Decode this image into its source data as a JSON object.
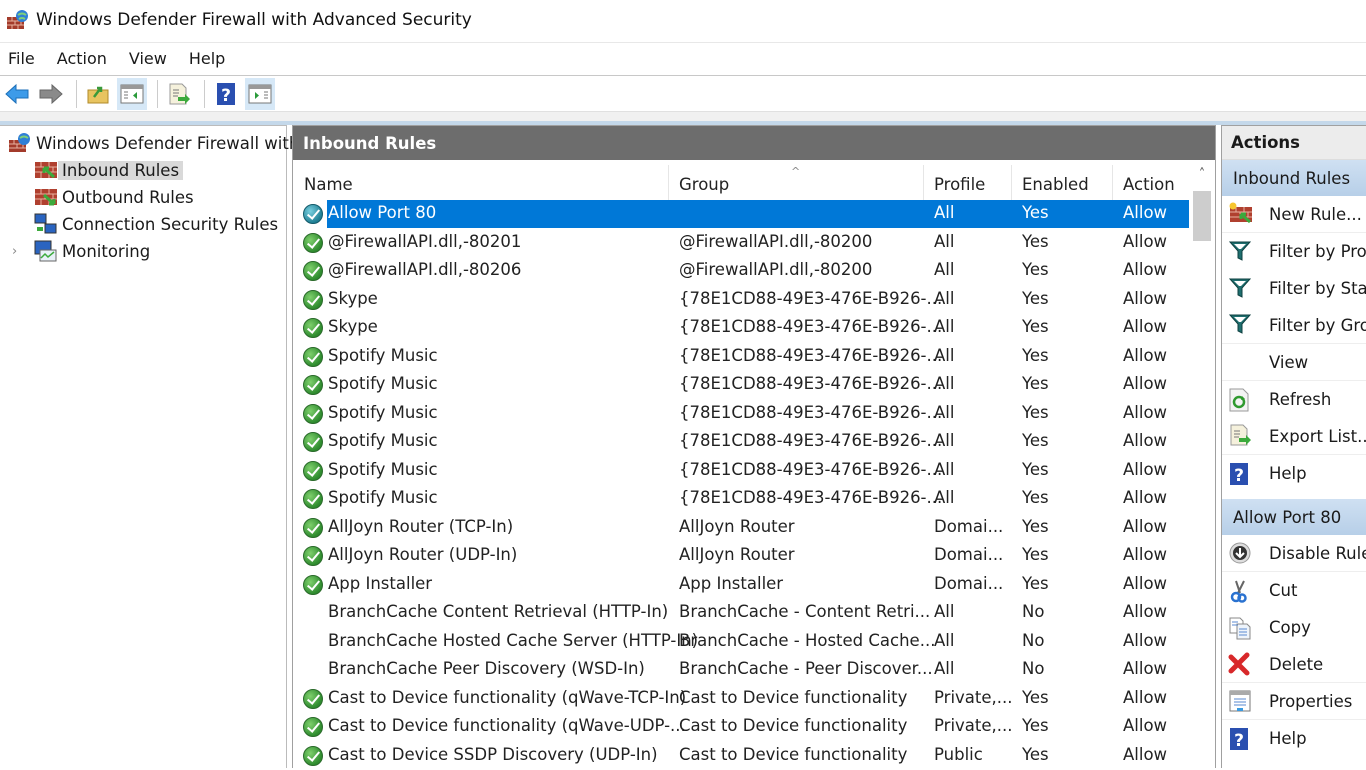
{
  "window": {
    "title": "Windows Defender Firewall with Advanced Security"
  },
  "menu": [
    "File",
    "Action",
    "View",
    "Help"
  ],
  "toolbar": [
    "back-icon",
    "forward-icon",
    "up-folder-icon",
    "show-hide-console-tree-icon",
    "export-list-icon",
    "help-icon",
    "show-hide-action-pane-icon"
  ],
  "tree": {
    "root": "Windows Defender Firewall with",
    "items": [
      {
        "label": "Inbound Rules",
        "selected": true
      },
      {
        "label": "Outbound Rules"
      },
      {
        "label": "Connection Security Rules"
      },
      {
        "label": "Monitoring",
        "expandable": true
      }
    ]
  },
  "center": {
    "title": "Inbound Rules",
    "columns": [
      "Name",
      "Group",
      "Profile",
      "Enabled",
      "Action"
    ],
    "sort_indicator": "^",
    "rows": [
      {
        "name": "Allow Port 80",
        "group": "",
        "profile": "All",
        "enabled": "Yes",
        "action": "Allow",
        "icon": "custom-enabled",
        "selected": true
      },
      {
        "name": "@FirewallAPI.dll,-80201",
        "group": "@FirewallAPI.dll,-80200",
        "profile": "All",
        "enabled": "Yes",
        "action": "Allow",
        "icon": "enabled"
      },
      {
        "name": "@FirewallAPI.dll,-80206",
        "group": "@FirewallAPI.dll,-80200",
        "profile": "All",
        "enabled": "Yes",
        "action": "Allow",
        "icon": "enabled"
      },
      {
        "name": "Skype",
        "group": "{78E1CD88-49E3-476E-B926-...",
        "profile": "All",
        "enabled": "Yes",
        "action": "Allow",
        "icon": "enabled"
      },
      {
        "name": "Skype",
        "group": "{78E1CD88-49E3-476E-B926-...",
        "profile": "All",
        "enabled": "Yes",
        "action": "Allow",
        "icon": "enabled"
      },
      {
        "name": "Spotify Music",
        "group": "{78E1CD88-49E3-476E-B926-...",
        "profile": "All",
        "enabled": "Yes",
        "action": "Allow",
        "icon": "enabled"
      },
      {
        "name": "Spotify Music",
        "group": "{78E1CD88-49E3-476E-B926-...",
        "profile": "All",
        "enabled": "Yes",
        "action": "Allow",
        "icon": "enabled"
      },
      {
        "name": "Spotify Music",
        "group": "{78E1CD88-49E3-476E-B926-...",
        "profile": "All",
        "enabled": "Yes",
        "action": "Allow",
        "icon": "enabled"
      },
      {
        "name": "Spotify Music",
        "group": "{78E1CD88-49E3-476E-B926-...",
        "profile": "All",
        "enabled": "Yes",
        "action": "Allow",
        "icon": "enabled"
      },
      {
        "name": "Spotify Music",
        "group": "{78E1CD88-49E3-476E-B926-...",
        "profile": "All",
        "enabled": "Yes",
        "action": "Allow",
        "icon": "enabled"
      },
      {
        "name": "Spotify Music",
        "group": "{78E1CD88-49E3-476E-B926-...",
        "profile": "All",
        "enabled": "Yes",
        "action": "Allow",
        "icon": "enabled"
      },
      {
        "name": "AllJoyn Router (TCP-In)",
        "group": "AllJoyn Router",
        "profile": "Domai...",
        "enabled": "Yes",
        "action": "Allow",
        "icon": "enabled"
      },
      {
        "name": "AllJoyn Router (UDP-In)",
        "group": "AllJoyn Router",
        "profile": "Domai...",
        "enabled": "Yes",
        "action": "Allow",
        "icon": "enabled"
      },
      {
        "name": "App Installer",
        "group": "App Installer",
        "profile": "Domai...",
        "enabled": "Yes",
        "action": "Allow",
        "icon": "enabled"
      },
      {
        "name": "BranchCache Content Retrieval (HTTP-In)",
        "group": "BranchCache - Content Retri...",
        "profile": "All",
        "enabled": "No",
        "action": "Allow",
        "icon": "none"
      },
      {
        "name": "BranchCache Hosted Cache Server (HTTP-In)",
        "group": "BranchCache - Hosted Cache...",
        "profile": "All",
        "enabled": "No",
        "action": "Allow",
        "icon": "none"
      },
      {
        "name": "BranchCache Peer Discovery (WSD-In)",
        "group": "BranchCache - Peer Discover...",
        "profile": "All",
        "enabled": "No",
        "action": "Allow",
        "icon": "none"
      },
      {
        "name": "Cast to Device functionality (qWave-TCP-In)",
        "group": "Cast to Device functionality",
        "profile": "Private,...",
        "enabled": "Yes",
        "action": "Allow",
        "icon": "enabled"
      },
      {
        "name": "Cast to Device functionality (qWave-UDP-...",
        "group": "Cast to Device functionality",
        "profile": "Private,...",
        "enabled": "Yes",
        "action": "Allow",
        "icon": "enabled"
      },
      {
        "name": "Cast to Device SSDP Discovery (UDP-In)",
        "group": "Cast to Device functionality",
        "profile": "Public",
        "enabled": "Yes",
        "action": "Allow",
        "icon": "enabled"
      }
    ]
  },
  "actions": {
    "title": "Actions",
    "sections": [
      {
        "header": "Inbound Rules",
        "items": [
          {
            "label": "New Rule...",
            "icon": "new-rule-icon"
          },
          {
            "label": "Filter by Profile",
            "icon": "filter-icon"
          },
          {
            "label": "Filter by State",
            "icon": "filter-icon"
          },
          {
            "label": "Filter by Group",
            "icon": "filter-icon"
          },
          {
            "label": "View",
            "icon": ""
          },
          {
            "label": "Refresh",
            "icon": "refresh-icon"
          },
          {
            "label": "Export List...",
            "icon": "export-list-icon"
          },
          {
            "label": "Help",
            "icon": "help-icon"
          }
        ]
      },
      {
        "header": "Allow Port 80",
        "items": [
          {
            "label": "Disable Rule",
            "icon": "disable-rule-icon"
          },
          {
            "label": "Cut",
            "icon": "cut-icon"
          },
          {
            "label": "Copy",
            "icon": "copy-icon"
          },
          {
            "label": "Delete",
            "icon": "delete-icon"
          },
          {
            "label": "Properties",
            "icon": "properties-icon"
          },
          {
            "label": "Help",
            "icon": "help-icon"
          }
        ]
      }
    ]
  },
  "colors": {
    "selection": "#0078d7",
    "header_bar": "#6d6d6d",
    "action_section": "#c4d8ee"
  }
}
